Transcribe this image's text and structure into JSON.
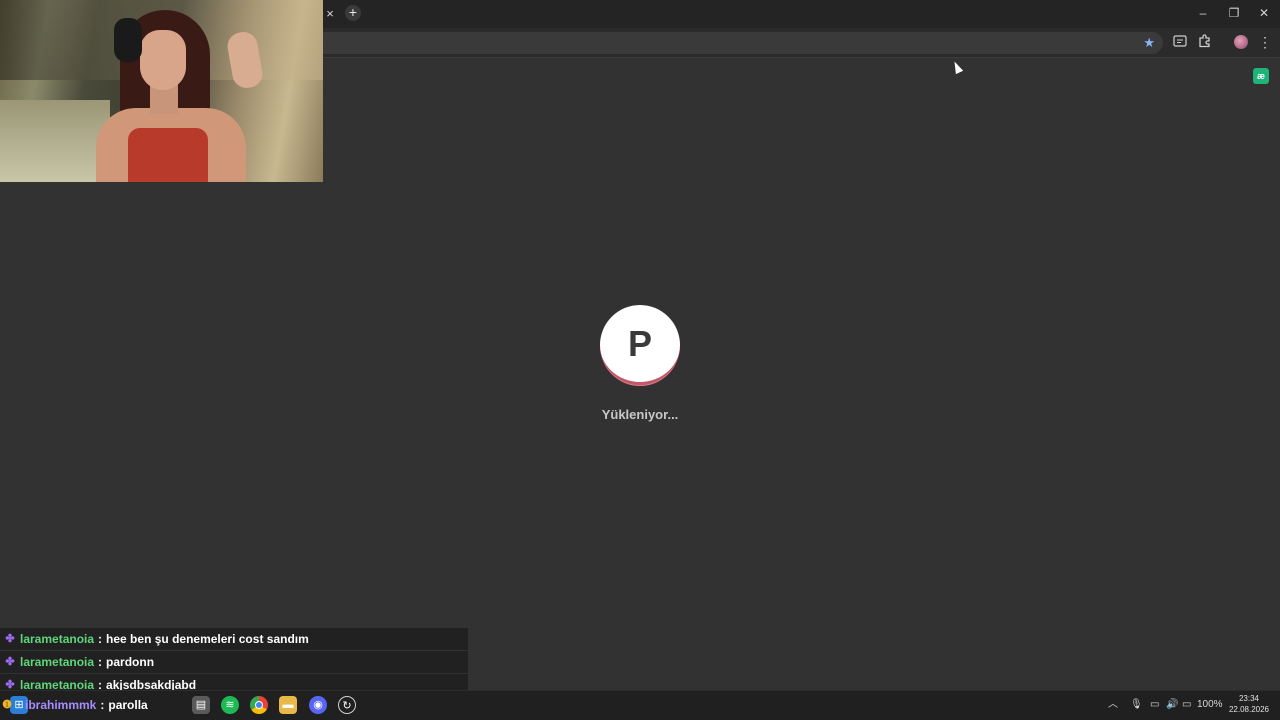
{
  "browser": {
    "tab_close_glyph": "×",
    "new_tab_glyph": "+",
    "window_controls": {
      "minimize": "–",
      "restore": "❐",
      "close": "✕"
    }
  },
  "toolbar": {
    "star_icon": "★",
    "menu_icon": "⋮"
  },
  "page": {
    "loader_letter": "P",
    "loading_text": "Yükleniyor...",
    "accent_color": "#c0586a",
    "extension_badge": "æ"
  },
  "chat": {
    "messages": [
      {
        "user": "larametanoia",
        "text": "hee ben şu denemeleri cost sandım"
      },
      {
        "user": "larametanoia",
        "text": "pardonn"
      },
      {
        "user": "larametanoia",
        "text": "akjsdbsakdjabd"
      },
      {
        "user": "ibrahimmmk",
        "text": "parolla"
      }
    ],
    "separator": ":"
  },
  "taskbar": {
    "apps": [
      "windows-start",
      "file-manager",
      "spotify",
      "chrome",
      "files",
      "discord",
      "updater"
    ],
    "battery": "100%",
    "time": "23:34",
    "date": "22.08.2026"
  }
}
